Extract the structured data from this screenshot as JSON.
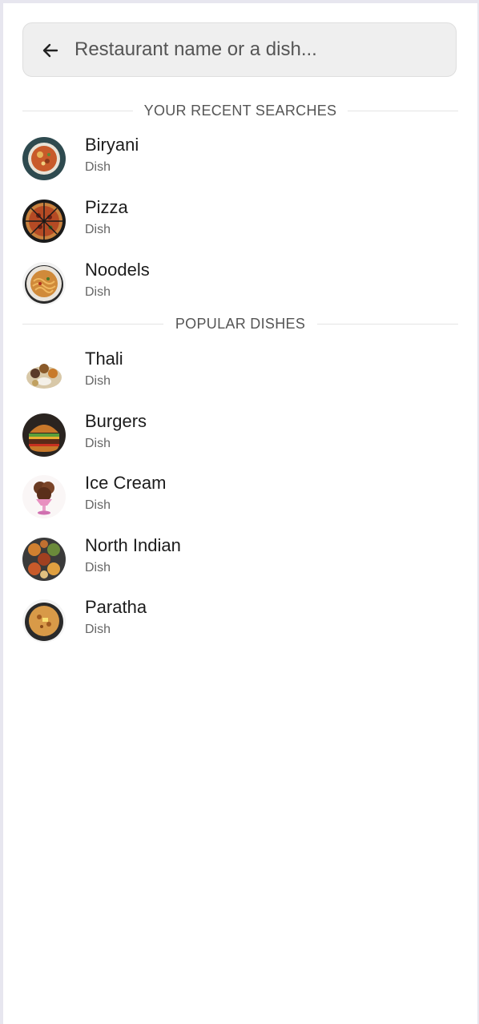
{
  "search": {
    "placeholder": "Restaurant name or a dish..."
  },
  "recent": {
    "title": "YOUR RECENT SEARCHES",
    "items": [
      {
        "name": "Biryani",
        "type": "Dish",
        "icon": "biryani-image"
      },
      {
        "name": "Pizza",
        "type": "Dish",
        "icon": "pizza-image"
      },
      {
        "name": "Noodels",
        "type": "Dish",
        "icon": "noodles-image"
      }
    ]
  },
  "popular": {
    "title": "POPULAR DISHES",
    "items": [
      {
        "name": "Thali",
        "type": "Dish",
        "icon": "thali-image"
      },
      {
        "name": "Burgers",
        "type": "Dish",
        "icon": "burger-image"
      },
      {
        "name": "Ice Cream",
        "type": "Dish",
        "icon": "ice-cream-image"
      },
      {
        "name": "North Indian",
        "type": "Dish",
        "icon": "north-indian-image"
      },
      {
        "name": "Paratha",
        "type": "Dish",
        "icon": "paratha-image"
      }
    ]
  },
  "colors": {
    "background": "#e7e6ef",
    "panel": "#ffffff",
    "search_bg": "#efefef",
    "text_primary": "#1c1c1c",
    "text_secondary": "#666666",
    "divider": "#e4e4e4"
  }
}
